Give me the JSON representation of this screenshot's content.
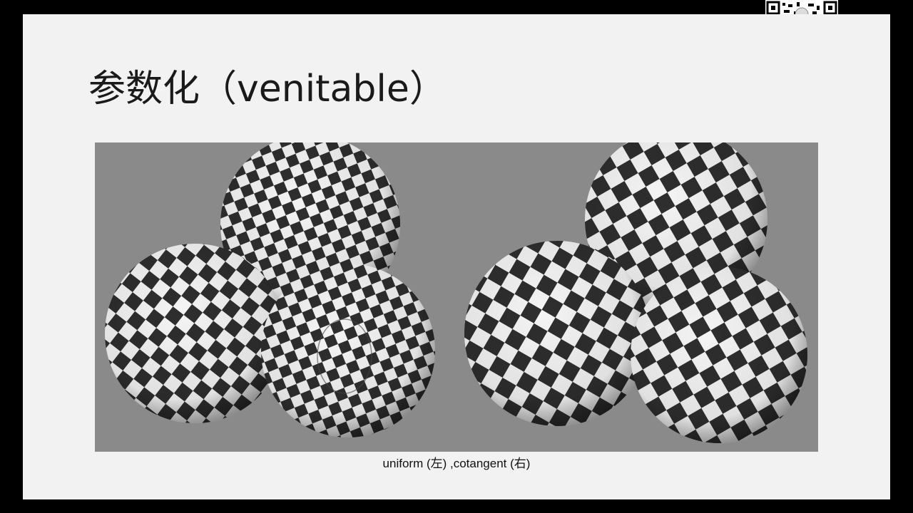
{
  "slide": {
    "title": "参数化（venitable）",
    "caption": "uniform (左) ,cotangent (右)"
  },
  "colors": {
    "background": "#000000",
    "slide": "#f2f2f2",
    "figure_bg": "#8a8a8a",
    "check_dark": "#2e2e2e",
    "check_light": "#f4f4f4"
  },
  "icons": {
    "qr": "qr-code-icon"
  }
}
